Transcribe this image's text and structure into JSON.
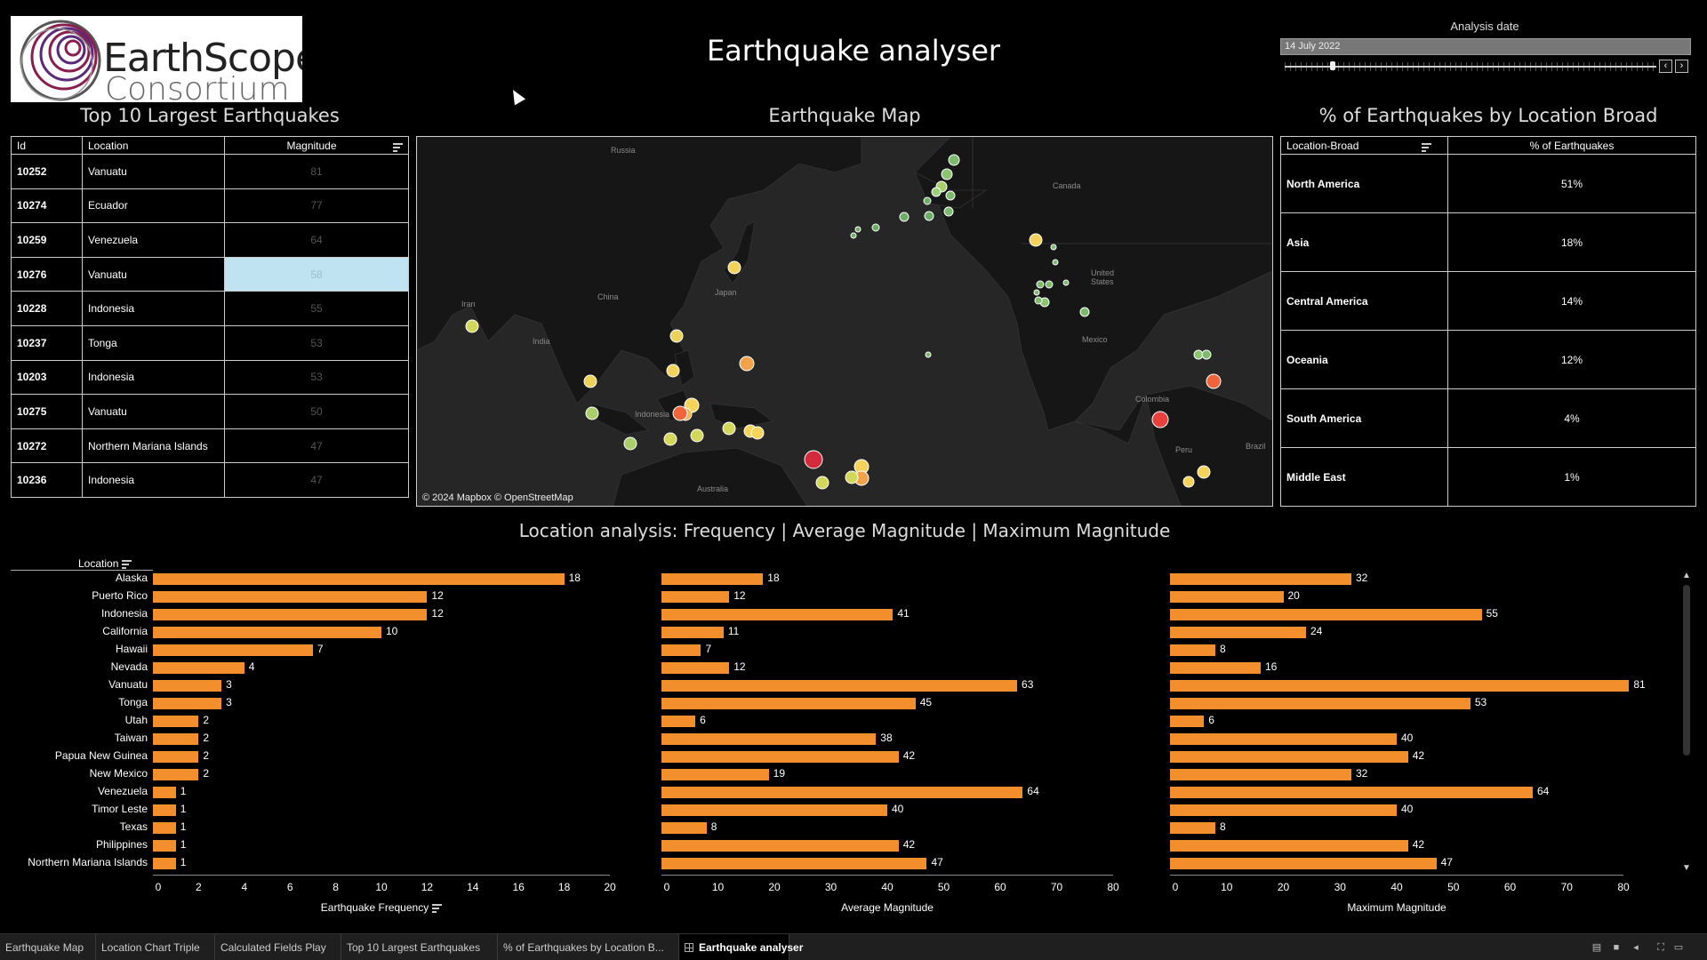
{
  "logo": {
    "line1": "EarthScope",
    "line2": "Consortium"
  },
  "title": "Earthquake analyser",
  "analysis_date": {
    "label": "Analysis date",
    "value": "14 July 2022",
    "prev": "‹",
    "next": "›"
  },
  "top10": {
    "title": "Top 10 Largest Earthquakes",
    "columns": [
      "Id",
      "Location",
      "Magnitude"
    ],
    "rows": [
      {
        "id": "10252",
        "location": "Vanuatu",
        "magnitude": "81"
      },
      {
        "id": "10274",
        "location": "Ecuador",
        "magnitude": "77"
      },
      {
        "id": "10259",
        "location": "Venezuela",
        "magnitude": "64"
      },
      {
        "id": "10276",
        "location": "Vanuatu",
        "magnitude": "58"
      },
      {
        "id": "10228",
        "location": "Indonesia",
        "magnitude": "55"
      },
      {
        "id": "10237",
        "location": "Tonga",
        "magnitude": "53"
      },
      {
        "id": "10203",
        "location": "Indonesia",
        "magnitude": "53"
      },
      {
        "id": "10275",
        "location": "Vanuatu",
        "magnitude": "50"
      },
      {
        "id": "10272",
        "location": "Northern Mariana Islands",
        "magnitude": "47"
      },
      {
        "id": "10236",
        "location": "Indonesia",
        "magnitude": "47"
      }
    ]
  },
  "map": {
    "title": "Earthquake Map",
    "labels": [
      "Russia",
      "Canada",
      "United States",
      "China",
      "Japan",
      "Iran",
      "India",
      "Mexico",
      "Indonesia",
      "Colombia",
      "Peru",
      "Brazil",
      "Australia"
    ],
    "attribution": "© 2024 Mapbox © OpenStreetMap"
  },
  "broad": {
    "title": "% of Earthquakes by Location Broad",
    "columns": [
      "Location-Broad",
      "% of Earthquakes"
    ],
    "rows": [
      {
        "location": "North America",
        "pct": "51%"
      },
      {
        "location": "Asia",
        "pct": "18%"
      },
      {
        "location": "Central America",
        "pct": "14%"
      },
      {
        "location": "Oceania",
        "pct": "12%"
      },
      {
        "location": "South America",
        "pct": "4%"
      },
      {
        "location": "Middle East",
        "pct": "1%"
      }
    ]
  },
  "location_analysis": {
    "title": "Location analysis: Frequency | Average Magnitude | Maximum Magnitude",
    "row_header": "Location"
  },
  "chart_data": [
    {
      "type": "bar",
      "title": "",
      "xlabel": "Earthquake Frequency",
      "xlim": [
        0,
        20
      ],
      "ticks": [
        0,
        2,
        4,
        6,
        8,
        10,
        12,
        14,
        16,
        18,
        20
      ],
      "categories": [
        "Alaska",
        "Puerto Rico",
        "Indonesia",
        "California",
        "Hawaii",
        "Nevada",
        "Vanuatu",
        "Tonga",
        "Utah",
        "Taiwan",
        "Papua New Guinea",
        "New Mexico",
        "Venezuela",
        "Timor Leste",
        "Texas",
        "Philippines",
        "Northern Mariana Islands"
      ],
      "values": [
        18,
        12,
        12,
        10,
        7,
        4,
        3,
        3,
        2,
        2,
        2,
        2,
        1,
        1,
        1,
        1,
        1
      ]
    },
    {
      "type": "bar",
      "title": "",
      "xlabel": "Average Magnitude",
      "xlim": [
        0,
        80
      ],
      "ticks": [
        0,
        10,
        20,
        30,
        40,
        50,
        60,
        70,
        80
      ],
      "categories": [
        "Alaska",
        "Puerto Rico",
        "Indonesia",
        "California",
        "Hawaii",
        "Nevada",
        "Vanuatu",
        "Tonga",
        "Utah",
        "Taiwan",
        "Papua New Guinea",
        "New Mexico",
        "Venezuela",
        "Timor Leste",
        "Texas",
        "Philippines",
        "Northern Mariana Islands"
      ],
      "values": [
        18,
        12,
        41,
        11,
        7,
        12,
        63,
        45,
        6,
        38,
        42,
        19,
        64,
        40,
        8,
        42,
        47
      ]
    },
    {
      "type": "bar",
      "title": "",
      "xlabel": "Maximum Magnitude",
      "xlim": [
        0,
        80
      ],
      "ticks": [
        0,
        10,
        20,
        30,
        40,
        50,
        60,
        70,
        80
      ],
      "categories": [
        "Alaska",
        "Puerto Rico",
        "Indonesia",
        "California",
        "Hawaii",
        "Nevada",
        "Vanuatu",
        "Tonga",
        "Utah",
        "Taiwan",
        "Papua New Guinea",
        "New Mexico",
        "Venezuela",
        "Timor Leste",
        "Texas",
        "Philippines",
        "Northern Mariana Islands"
      ],
      "values": [
        32,
        20,
        55,
        24,
        8,
        16,
        81,
        53,
        6,
        40,
        42,
        32,
        64,
        40,
        8,
        42,
        47
      ]
    }
  ],
  "colors": {
    "bar": "#f28e2b",
    "selected_cell": "#bfe3f1"
  },
  "tabs": [
    "Earthquake Map",
    "Location Chart Triple",
    "Calculated Fields Play",
    "Top 10 Largest Earthquakes",
    "% of Earthquakes by Location B...",
    "Earthquake analyser"
  ],
  "active_tab": 5
}
